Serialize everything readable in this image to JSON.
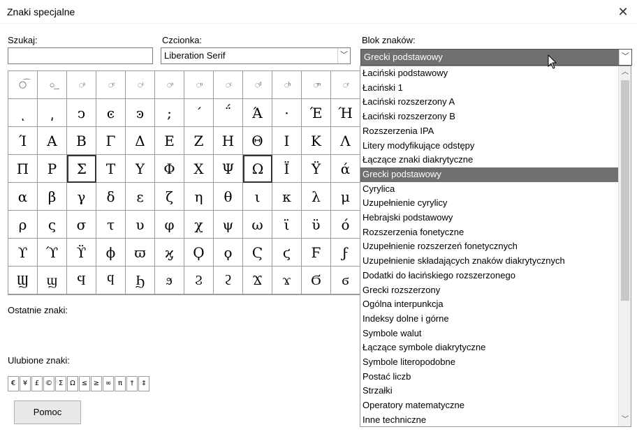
{
  "window": {
    "title": "Znaki specjalne",
    "close_glyph": "✕"
  },
  "search": {
    "label": "Szukaj:",
    "value": ""
  },
  "font": {
    "label": "Czcionka:",
    "value": "Liberation Serif"
  },
  "block": {
    "label": "Blok znaków:",
    "value": "Grecki podstawowy"
  },
  "char_grid": [
    [
      "○͡",
      "○͢",
      "◌ͣ",
      "◌ͤ",
      "◌ͥ",
      "◌ͦ",
      "◌ͧ",
      "◌ͨ",
      "◌ͩ",
      "◌ͪ",
      "◌ͫ",
      "◌ͬ"
    ],
    [
      "ͺ",
      "͵",
      "ͻ",
      "ͼ",
      "ͽ",
      ";",
      "΄",
      "΅",
      "Ά",
      "·",
      "Έ",
      "Ή"
    ],
    [
      "Ί",
      "Α",
      "Β",
      "Γ",
      "Δ",
      "Ε",
      "Ζ",
      "Η",
      "Θ",
      "Ι",
      "Κ",
      "Λ"
    ],
    [
      "Π",
      "Ρ",
      "Σ",
      "Τ",
      "Υ",
      "Φ",
      "Χ",
      "Ψ",
      "Ω",
      "Ϊ",
      "Ϋ",
      "ά"
    ],
    [
      "α",
      "β",
      "γ",
      "δ",
      "ε",
      "ζ",
      "η",
      "θ",
      "ι",
      "κ",
      "λ",
      "μ"
    ],
    [
      "ρ",
      "ς",
      "σ",
      "τ",
      "υ",
      "φ",
      "χ",
      "ψ",
      "ω",
      "ϊ",
      "ϋ",
      "ό"
    ],
    [
      "ϒ",
      "ϓ",
      "ϔ",
      "ϕ",
      "ϖ",
      "ϗ",
      "Ϙ",
      "ϙ",
      "Ϛ",
      "ϛ",
      "Ϝ",
      "ϝ"
    ],
    [
      "Ϣ",
      "ϣ",
      "Ϥ",
      "ϥ",
      "Ϧ",
      "ϧ",
      "Ϩ",
      "ϩ",
      "Ϫ",
      "ϫ",
      "Ϭ",
      "ϭ"
    ]
  ],
  "recent": {
    "label": "Ostatnie znaki:"
  },
  "favorites": {
    "label": "Ulubione znaki:",
    "items": [
      "€",
      "¥",
      "£",
      "©",
      "Σ",
      "Ω",
      "≤",
      "≥",
      "∞",
      "π",
      "†",
      "‡"
    ]
  },
  "help_button": {
    "label": "Pomoc"
  },
  "block_list": {
    "selected_index": 7,
    "items": [
      "Łaciński podstawowy",
      "Łaciński 1",
      "Łaciński rozszerzony A",
      "Łaciński rozszerzony B",
      "Rozszerzenia IPA",
      "Litery modyfikujące odstępy",
      "Łączące znaki diakrytyczne",
      "Grecki podstawowy",
      "Cyrylica",
      "Uzupełnienie cyrylicy",
      "Hebrajski podstawowy",
      "Rozszerzenia fonetyczne",
      "Uzupełnienie rozszerzeń fonetycznych",
      "Uzupełnienie składających znaków diakrytycznych",
      "Dodatki do łacińskiego rozszerzonego",
      "Grecki rozszerzony",
      "Ogólna interpunkcja",
      "Indeksy dolne i górne",
      "Symbole walut",
      "Łączące symbole diakrytyczne",
      "Symbole literopodobne",
      "Postać liczb",
      "Strzałki",
      "Operatory matematyczne",
      "Inne techniczne"
    ]
  },
  "colors": {
    "selection": "#707070",
    "border": "#9a9a9a"
  },
  "icons": {
    "dropdown": "chevron-down-icon",
    "close": "close-icon"
  }
}
